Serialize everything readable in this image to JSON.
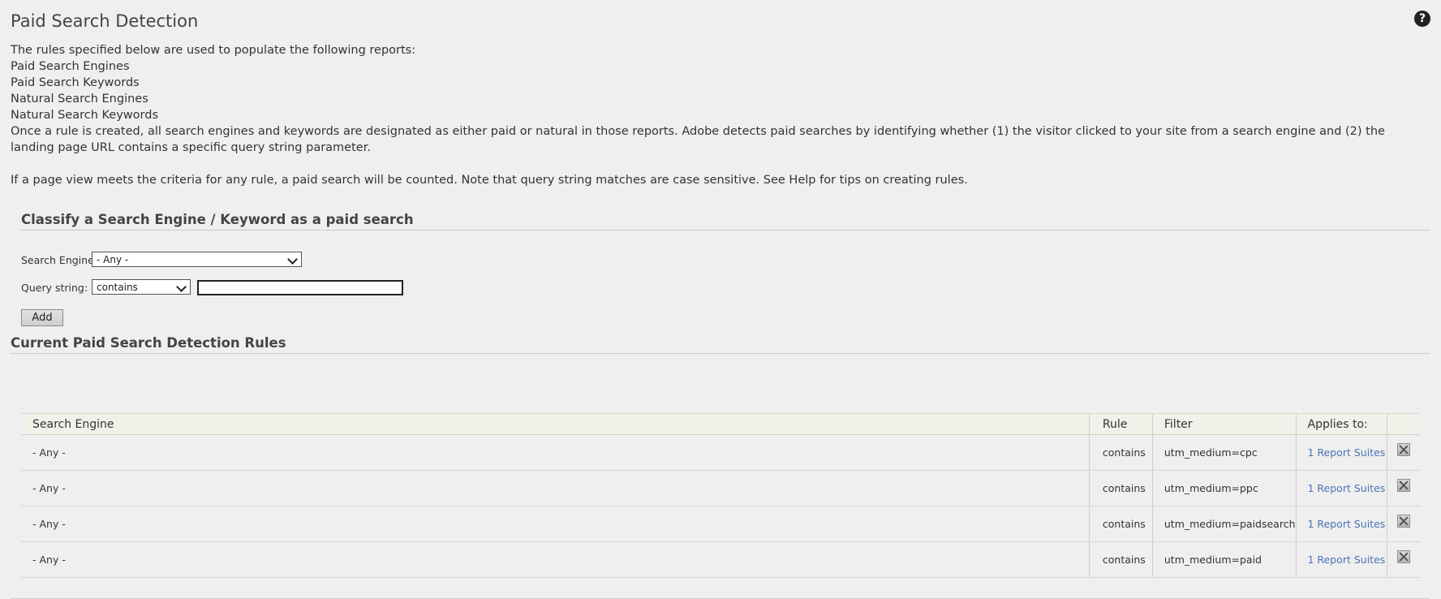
{
  "page": {
    "title": "Paid Search Detection",
    "help_icon": "?"
  },
  "intro": {
    "lead": "The rules specified below are used to populate the following reports:",
    "reports": [
      "Paid Search Engines",
      "Paid Search Keywords",
      "Natural Search Engines",
      "Natural Search Keywords"
    ],
    "description": "Once a rule is created, all search engines and keywords are designated as either paid or natural in those reports. Adobe detects paid searches by identifying whether (1) the visitor clicked to your site from a search engine and (2) the landing page URL contains a specific query string parameter.",
    "note": "If a page view meets the criteria for any rule, a paid search will be counted. Note that query string matches are case sensitive. See Help for tips on creating rules."
  },
  "classify": {
    "title": "Classify a Search Engine / Keyword as a paid search",
    "search_engine_label": "Search Engine:",
    "search_engine_value": "- Any -",
    "query_string_label": "Query string:",
    "query_operator_value": "contains",
    "query_value": "",
    "add_label": "Add"
  },
  "current": {
    "title": "Current Paid Search Detection Rules",
    "columns": {
      "engine": "Search Engine",
      "rule": "Rule",
      "filter": "Filter",
      "applies": "Applies to:"
    },
    "rows": [
      {
        "engine": "- Any -",
        "rule": "contains",
        "filter": "utm_medium=cpc",
        "applies": "1 Report Suites"
      },
      {
        "engine": "- Any -",
        "rule": "contains",
        "filter": "utm_medium=ppc",
        "applies": "1 Report Suites"
      },
      {
        "engine": "- Any -",
        "rule": "contains",
        "filter": "utm_medium=paidsearch",
        "applies": "1 Report Suites"
      },
      {
        "engine": "- Any -",
        "rule": "contains",
        "filter": "utm_medium=paid",
        "applies": "1 Report Suites"
      }
    ]
  },
  "colors": {
    "background": "#efefef",
    "link": "#4a74b4",
    "header_row": "#f1f1ea"
  },
  "icons": {
    "help": "question-circle-icon",
    "delete": "delete-x-icon",
    "dropdown": "chevron-down-icon"
  }
}
